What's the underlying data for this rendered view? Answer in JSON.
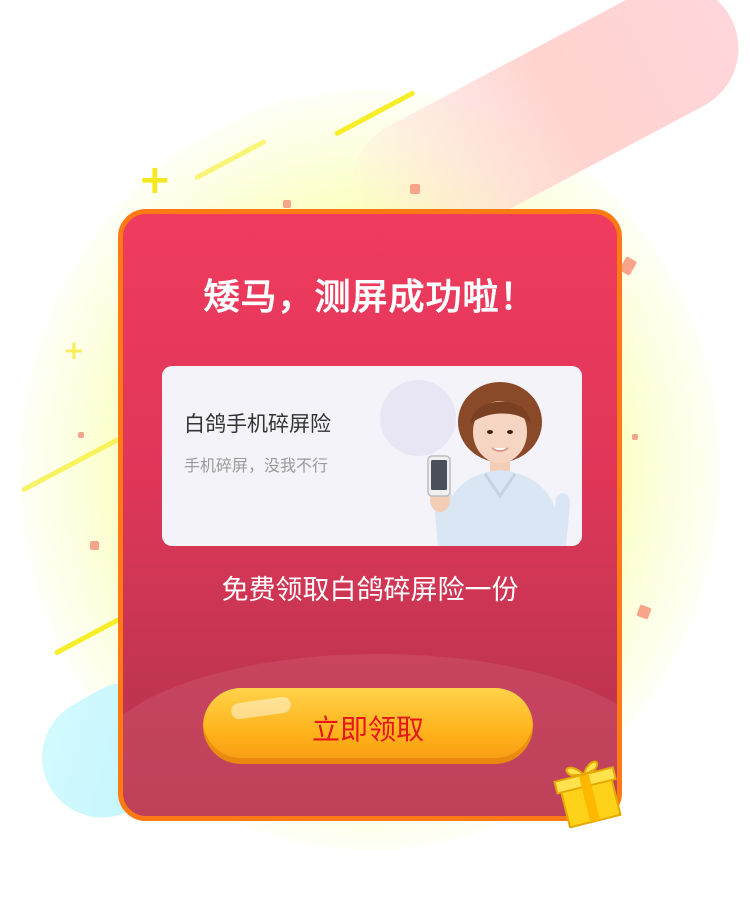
{
  "popup": {
    "title": "矮马，测屏成功啦！",
    "product": {
      "name": "白鸽手机碎屏险",
      "description": "手机碎屏，没我不行"
    },
    "offer_text": "免费领取白鸽碎屏险一份",
    "claim_button_label": "立即领取"
  },
  "icons": {
    "gift": "gift-box-icon",
    "sparkle": "plus-sparkle-icon"
  },
  "colors": {
    "card_border": "#ff7a14",
    "card_top": "#ef3b5e",
    "card_bottom": "#b8314d",
    "button": "#ffb21a",
    "button_text": "#e8141c",
    "accent_yellow": "#f5ee29"
  }
}
